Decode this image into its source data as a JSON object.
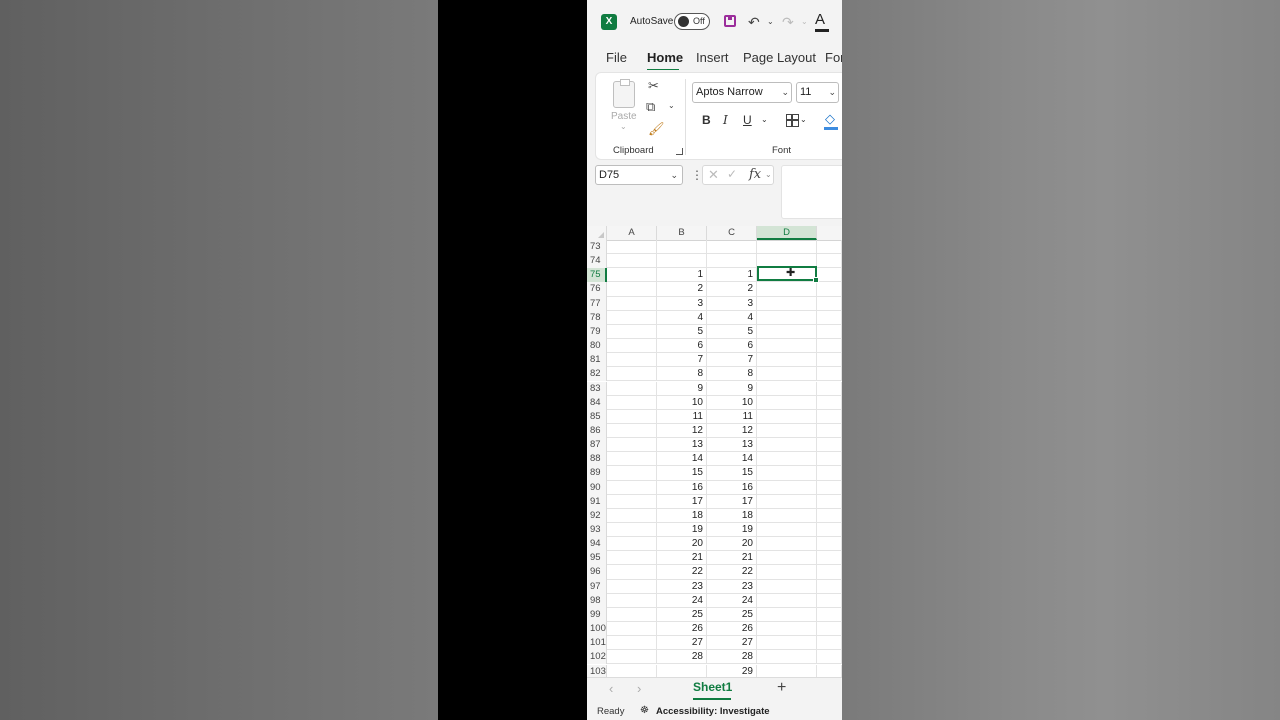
{
  "titlebar": {
    "app_icon": "excel-logo",
    "autosave_label": "AutoSave",
    "autosave_state": "Off",
    "icons": [
      "save-icon",
      "undo-icon",
      "redo-icon",
      "font-color-icon"
    ]
  },
  "tabs": [
    "File",
    "Home",
    "Insert",
    "Page Layout",
    "For"
  ],
  "active_tab": "Home",
  "ribbon": {
    "clipboard": {
      "paste_label": "Paste",
      "group_label": "Clipboard",
      "icons": [
        "cut-icon",
        "copy-icon",
        "format-painter-icon"
      ]
    },
    "font": {
      "font_name": "Aptos Narrow",
      "font_size": "11",
      "bold": "B",
      "italic": "I",
      "underline": "U",
      "group_label": "Font"
    }
  },
  "formula_bar": {
    "name_box": "D75",
    "fx_label": "fx",
    "formula": ""
  },
  "grid": {
    "columns": [
      "A",
      "B",
      "C",
      "D"
    ],
    "selected_column": "D",
    "selected_cell": "D75",
    "rows": [
      {
        "n": "73",
        "b": "",
        "c": ""
      },
      {
        "n": "74",
        "b": "",
        "c": ""
      },
      {
        "n": "75",
        "b": "1",
        "c": "1"
      },
      {
        "n": "76",
        "b": "2",
        "c": "2"
      },
      {
        "n": "77",
        "b": "3",
        "c": "3"
      },
      {
        "n": "78",
        "b": "4",
        "c": "4"
      },
      {
        "n": "79",
        "b": "5",
        "c": "5"
      },
      {
        "n": "80",
        "b": "6",
        "c": "6"
      },
      {
        "n": "81",
        "b": "7",
        "c": "7"
      },
      {
        "n": "82",
        "b": "8",
        "c": "8"
      },
      {
        "n": "83",
        "b": "9",
        "c": "9"
      },
      {
        "n": "84",
        "b": "10",
        "c": "10"
      },
      {
        "n": "85",
        "b": "11",
        "c": "11"
      },
      {
        "n": "86",
        "b": "12",
        "c": "12"
      },
      {
        "n": "87",
        "b": "13",
        "c": "13"
      },
      {
        "n": "88",
        "b": "14",
        "c": "14"
      },
      {
        "n": "89",
        "b": "15",
        "c": "15"
      },
      {
        "n": "90",
        "b": "16",
        "c": "16"
      },
      {
        "n": "91",
        "b": "17",
        "c": "17"
      },
      {
        "n": "92",
        "b": "18",
        "c": "18"
      },
      {
        "n": "93",
        "b": "19",
        "c": "19"
      },
      {
        "n": "94",
        "b": "20",
        "c": "20"
      },
      {
        "n": "95",
        "b": "21",
        "c": "21"
      },
      {
        "n": "96",
        "b": "22",
        "c": "22"
      },
      {
        "n": "97",
        "b": "23",
        "c": "23"
      },
      {
        "n": "98",
        "b": "24",
        "c": "24"
      },
      {
        "n": "99",
        "b": "25",
        "c": "25"
      },
      {
        "n": "100",
        "b": "26",
        "c": "26"
      },
      {
        "n": "101",
        "b": "27",
        "c": "27"
      },
      {
        "n": "102",
        "b": "28",
        "c": "28"
      },
      {
        "n": "103",
        "b": "",
        "c": "29"
      }
    ]
  },
  "sheets": {
    "active": "Sheet1",
    "add_label": "+"
  },
  "status": {
    "ready": "Ready",
    "accessibility": "Accessibility: Investigate"
  },
  "colors": {
    "accent": "#107c41",
    "background_left": "#6e6e6e",
    "background_right": "#8a8a8a"
  }
}
